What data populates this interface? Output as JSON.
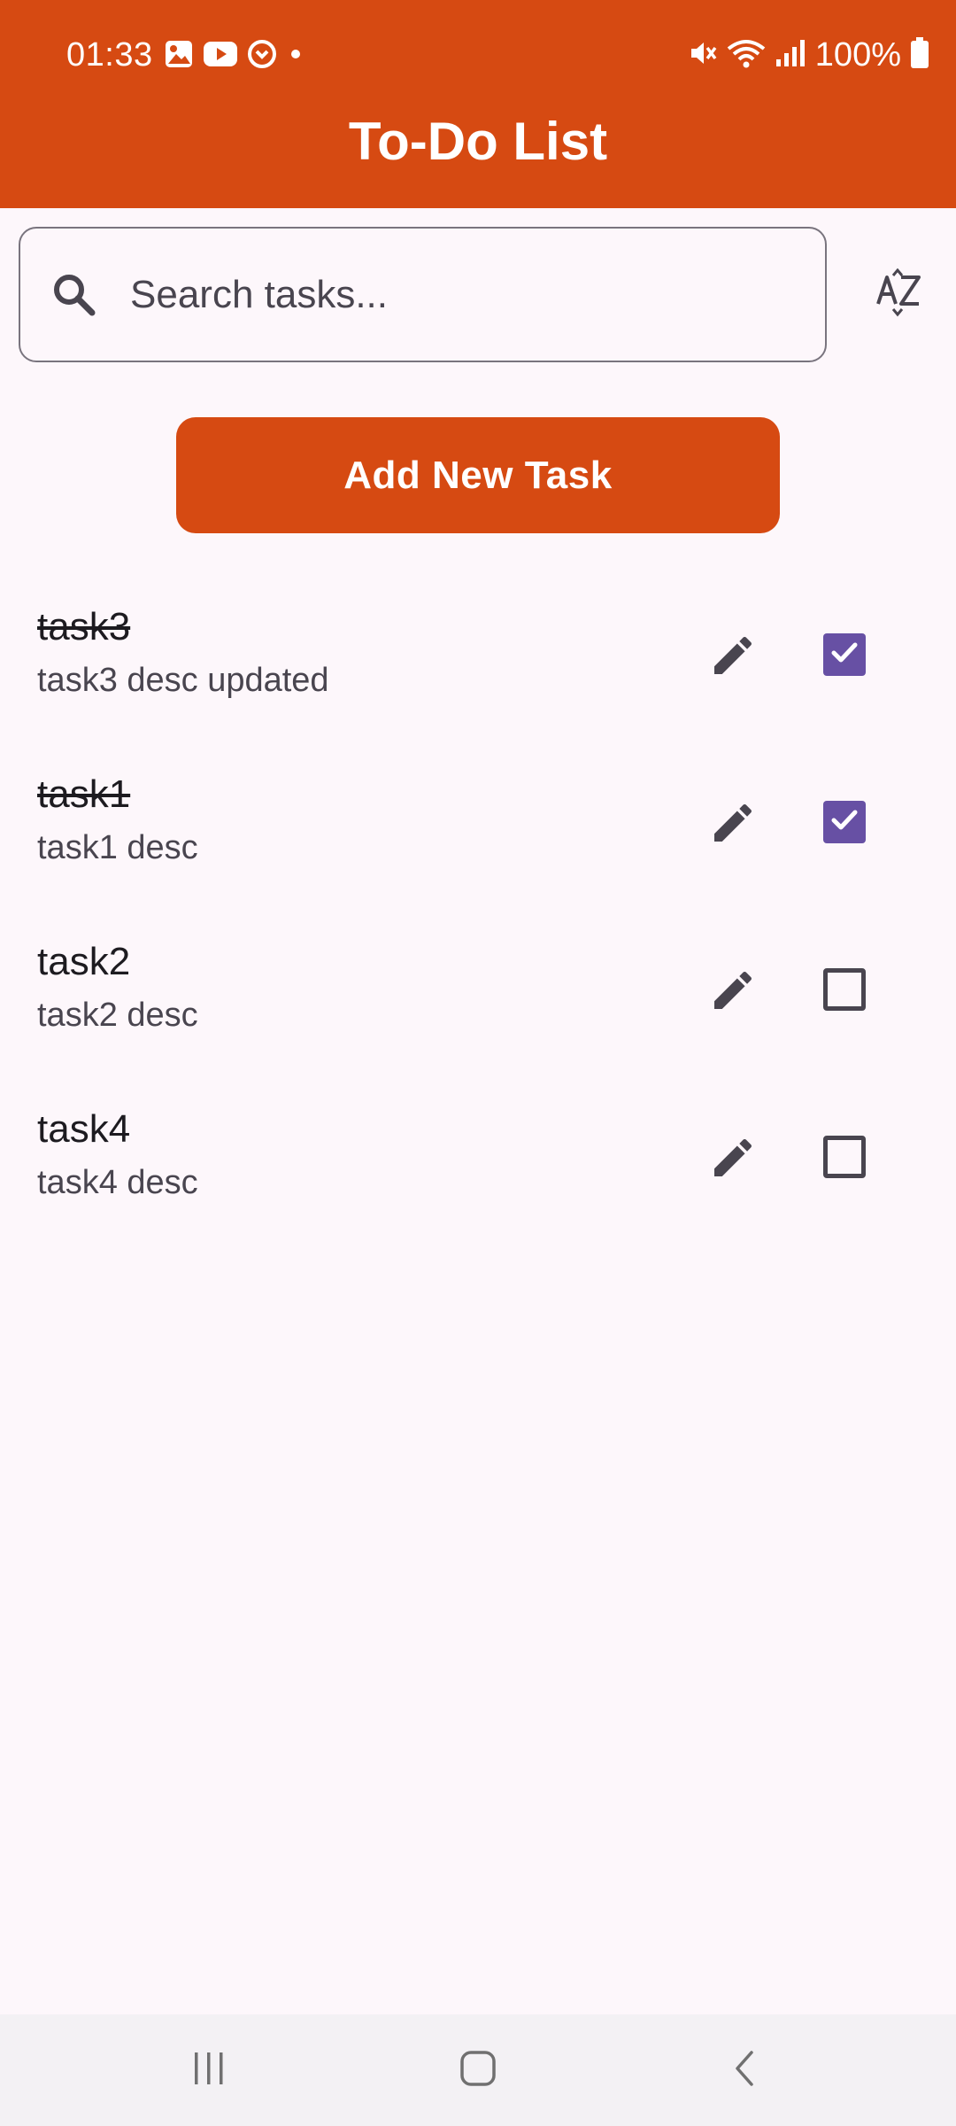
{
  "status_bar": {
    "time": "01:33",
    "battery": "100%",
    "left_icons": [
      "gallery-icon",
      "youtube-icon",
      "app-notification-icon",
      "dot-icon"
    ],
    "right_icons": [
      "mute-icon",
      "wifi-icon",
      "signal-icon",
      "battery-icon"
    ]
  },
  "app_bar": {
    "title": "To-Do List",
    "color": "#d64a12"
  },
  "search": {
    "placeholder": "Search tasks...",
    "value": "",
    "icon": "search-icon",
    "sort_icon": "sort-alpha-icon"
  },
  "add_button": {
    "label": "Add New Task",
    "color": "#d64a12"
  },
  "tasks": [
    {
      "title": "task3",
      "description": "task3 desc updated",
      "done": true
    },
    {
      "title": "task1",
      "description": "task1 desc",
      "done": true
    },
    {
      "title": "task2",
      "description": "task2 desc",
      "done": false
    },
    {
      "title": "task4",
      "description": "task4 desc",
      "done": false
    }
  ],
  "colors": {
    "checkbox_checked": "#6750a4",
    "background": "#fdf7fb"
  },
  "nav_bar": {
    "buttons": [
      "recents-icon",
      "home-icon",
      "back-icon"
    ]
  }
}
